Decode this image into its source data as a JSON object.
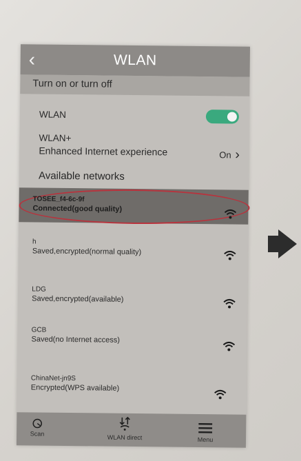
{
  "header": {
    "back_icon": "chevron-left-icon",
    "title": "WLAN"
  },
  "section": {
    "toggle_heading": "Turn on or turn off"
  },
  "wlan_row": {
    "label": "WLAN",
    "toggle_on": true,
    "toggle_color": "#3aa97e"
  },
  "wlan_plus": {
    "title": "WLAN+",
    "subtitle": "Enhanced Internet experience",
    "value": "On",
    "chevron_icon": "chevron-right-icon"
  },
  "available_label": "Available networks",
  "networks": [
    {
      "name": "TOSEE_f4-6c-9f",
      "status": "Connected(good quality)",
      "signal_icon": "wifi-signal-icon",
      "highlighted": true
    },
    {
      "name": "h",
      "status": "Saved,encrypted(normal quality)",
      "signal_icon": "wifi-signal-icon",
      "highlighted": false
    },
    {
      "name": "LDG",
      "status": "Saved,encrypted(available)",
      "signal_icon": "wifi-signal-icon",
      "highlighted": false
    },
    {
      "name": "GCB",
      "status": "Saved(no Internet access)",
      "signal_icon": "wifi-signal-icon",
      "highlighted": false
    },
    {
      "name": "ChinaNet-jn9S",
      "status": "Encrypted(WPS available)",
      "signal_icon": "wifi-signal-icon",
      "highlighted": false
    }
  ],
  "bottom_bar": {
    "scan_label": "Scan",
    "scan_icon": "scan-icon",
    "direct_label": "WLAN direct",
    "direct_icon": "wlan-direct-icon",
    "menu_label": "Menu",
    "menu_icon": "menu-icon"
  },
  "annotation": {
    "highlight_color": "#b8333d",
    "arrow_icon": "arrow-right-icon"
  }
}
